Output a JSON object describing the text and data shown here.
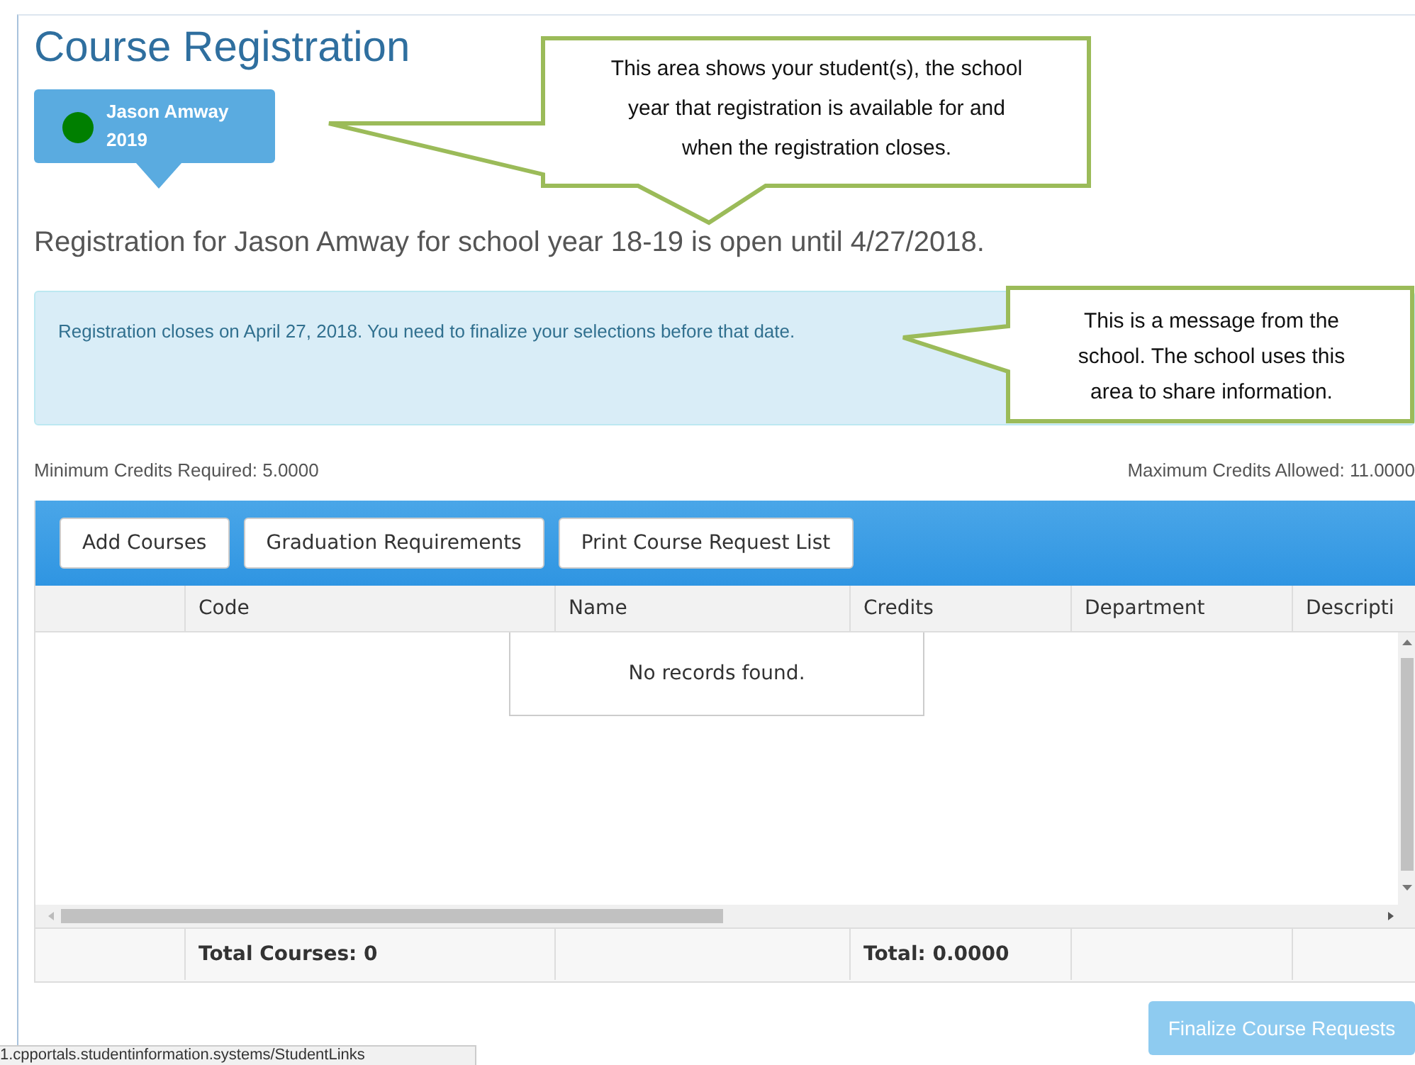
{
  "title": "Course Registration",
  "students": [
    {
      "name": "Jason Amway",
      "year": "2019",
      "color": "#007f00",
      "selected": true
    }
  ],
  "headline": "Registration for Jason Amway for school year 18-19 is open until 4/27/2018.",
  "alert": "Registration closes on April 27, 2018.  You need to finalize your selections before that date.",
  "min_credits": "Minimum Credits Required: 5.0000",
  "max_credits": "Maximum Credits Allowed: 11.0000",
  "toolbar_buttons": [
    "Add Courses",
    "Graduation Requirements",
    "Print Course Request List"
  ],
  "table": {
    "columns": [
      {
        "label": "Code",
        "footer": "Total Courses: 0"
      },
      {
        "label": "Name"
      },
      {
        "label": "Credits",
        "footer": "Total: 0.0000"
      },
      {
        "label": "Department"
      },
      {
        "label": "Descripti"
      }
    ],
    "empty_message": "No records found."
  },
  "finalize_button": {
    "label": "Finalize Course Requests",
    "disabled": true
  },
  "status_url": "1.cpportals.studentinformation.systems/StudentLinks",
  "callouts": [
    {
      "kind": "top",
      "text": "This area shows your student(s), the school year that registration is available for and when the registration closes."
    },
    {
      "kind": "left",
      "text": "This is a message from the school. The school uses this area to share information."
    }
  ]
}
